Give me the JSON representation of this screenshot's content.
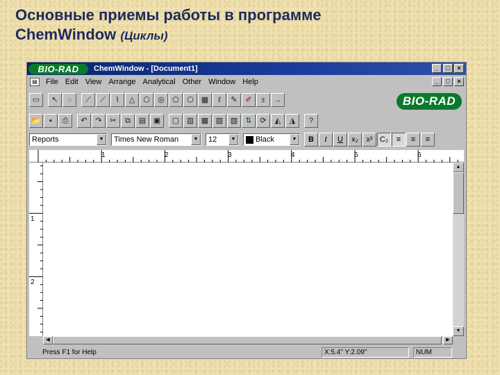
{
  "slide": {
    "title_line1": "Основные приемы работы в программе",
    "title_line2_main": "ChemWindow",
    "title_line2_sub": "(Циклы)"
  },
  "window": {
    "logo": "BIO-RAD",
    "title": "ChemWindow - [Document1]",
    "controls": [
      "_",
      "□",
      "×"
    ],
    "logo_color": "#0a7a2a",
    "titlebar_color": "#08246b"
  },
  "menu": {
    "items": [
      "File",
      "Edit",
      "View",
      "Arrange",
      "Analytical",
      "Other",
      "Window",
      "Help"
    ],
    "doc_controls": [
      "_",
      "□",
      "×"
    ]
  },
  "toolbar1": {
    "icons": [
      "new-doc-icon",
      "select-arrow-icon",
      "lasso-icon",
      "bond-icon",
      "wedge-bond-icon",
      "chain-icon",
      "cyclopropane-icon",
      "cyclohexane-icon",
      "benzene-icon",
      "cyclopentane-icon",
      "cycloheptane-icon",
      "template-icon",
      "orbital-icon",
      "pen-icon",
      "eraser-icon",
      "charge-icon",
      "arrow-tool-icon"
    ],
    "glyphs": [
      "▭",
      "↖",
      "◌",
      "⟋",
      "⟋",
      "⌇",
      "△",
      "⬡",
      "◎",
      "⬠",
      "⬡",
      "▦",
      "ℓ",
      "✎",
      "✐",
      "±",
      "→"
    ]
  },
  "toolbar2": {
    "icons": [
      "open-icon",
      "save-icon",
      "print-icon",
      "undo-icon",
      "redo-icon",
      "cut-icon",
      "copy-icon",
      "paste-icon",
      "group-icon",
      "ungroup-icon",
      "align-icon",
      "distribute-icon",
      "bring-front-icon",
      "send-back-icon",
      "flip-icon",
      "rotate-icon",
      "mirror-icon",
      "zoom-icon",
      "help-icon"
    ],
    "glyphs": [
      "📂",
      "▪",
      "⎙",
      "↶",
      "↷",
      "✂",
      "⧉",
      "▤",
      "▣",
      "▢",
      "▥",
      "▦",
      "▧",
      "▨",
      "⇅",
      "⟳",
      "◭",
      "◮",
      "?"
    ]
  },
  "format": {
    "style": "Reports",
    "font": "Times New Roman",
    "size": "12",
    "color": "Black",
    "bold": "B",
    "italic": "I",
    "underline": "U",
    "subscript": "x₂",
    "superscript": "x²",
    "chem": "C₂",
    "align": [
      "≡",
      "≡",
      "≡"
    ]
  },
  "rulers": {
    "h_labels": [
      "1",
      "2",
      "3",
      "4",
      "5",
      "6"
    ],
    "v_labels": [
      "1",
      "2"
    ]
  },
  "status": {
    "help": "Press F1 for Help",
    "coords": "X:5.4\" Y:2.09\"",
    "num": "NUM"
  }
}
